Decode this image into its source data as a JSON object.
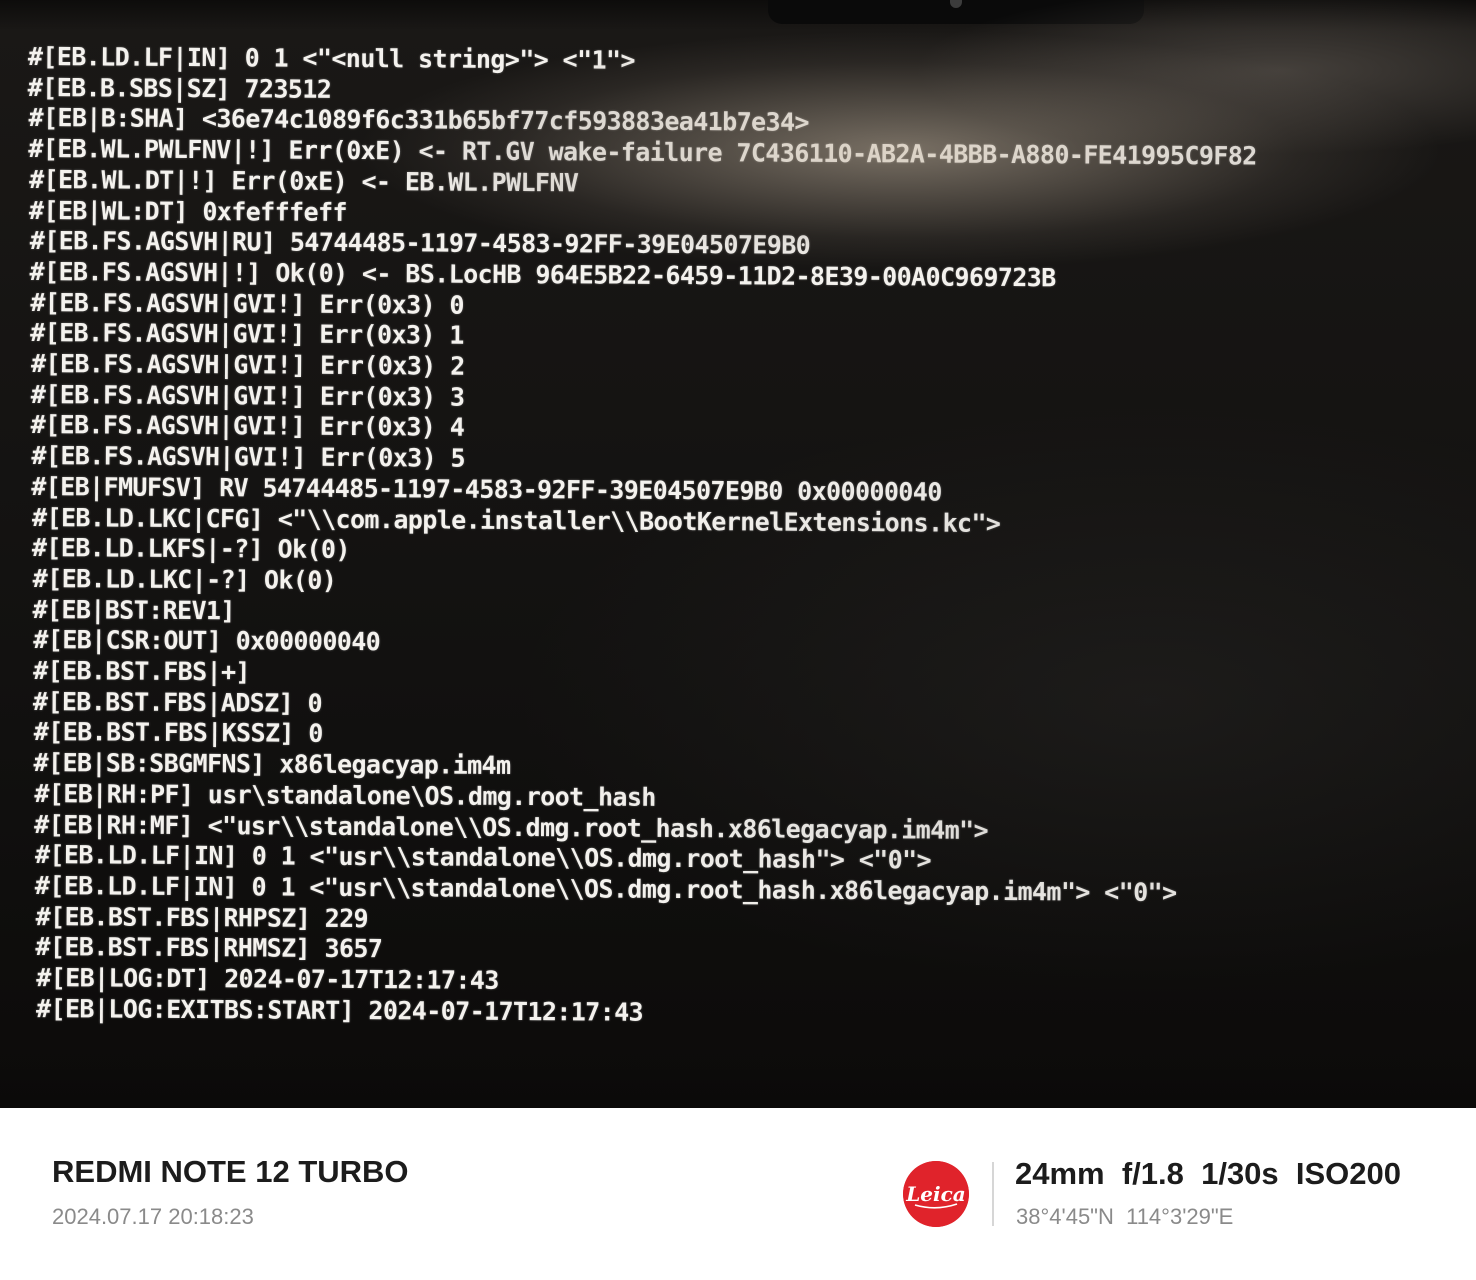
{
  "terminal": {
    "lines": [
      "#[EB.LD.LF|IN] 0 1 <\"<null string>\"> <\"1\">",
      "#[EB.B.SBS|SZ] 723512",
      "#[EB|B:SHA] <36e74c1089f6c331b65bf77cf593883ea41b7e34>",
      "#[EB.WL.PWLFNV|!] Err(0xE) <- RT.GV wake-failure 7C436110-AB2A-4BBB-A880-FE41995C9F82",
      "#[EB.WL.DT|!] Err(0xE) <- EB.WL.PWLFNV",
      "#[EB|WL:DT] 0xfefffeff",
      "#[EB.FS.AGSVH|RU] 54744485-1197-4583-92FF-39E04507E9B0",
      "#[EB.FS.AGSVH|!] Ok(0) <- BS.LocHB 964E5B22-6459-11D2-8E39-00A0C969723B",
      "#[EB.FS.AGSVH|GVI!] Err(0x3) 0",
      "#[EB.FS.AGSVH|GVI!] Err(0x3) 1",
      "#[EB.FS.AGSVH|GVI!] Err(0x3) 2",
      "#[EB.FS.AGSVH|GVI!] Err(0x3) 3",
      "#[EB.FS.AGSVH|GVI!] Err(0x3) 4",
      "#[EB.FS.AGSVH|GVI!] Err(0x3) 5",
      "#[EB|FMUFSV] RV 54744485-1197-4583-92FF-39E04507E9B0 0x00000040",
      "#[EB.LD.LKC|CFG] <\"\\\\com.apple.installer\\\\BootKernelExtensions.kc\">",
      "#[EB.LD.LKFS|-?] Ok(0)",
      "#[EB.LD.LKC|-?] Ok(0)",
      "#[EB|BST:REV1]",
      "#[EB|CSR:OUT] 0x00000040",
      "#[EB.BST.FBS|+]",
      "#[EB.BST.FBS|ADSZ] 0",
      "#[EB.BST.FBS|KSSZ] 0",
      "#[EB|SB:SBGMFNS] x86legacyap.im4m",
      "#[EB|RH:PF] usr\\standalone\\OS.dmg.root_hash",
      "#[EB|RH:MF] <\"usr\\\\standalone\\\\OS.dmg.root_hash.x86legacyap.im4m\">",
      "#[EB.LD.LF|IN] 0 1 <\"usr\\\\standalone\\\\OS.dmg.root_hash\"> <\"0\">",
      "#[EB.LD.LF|IN] 0 1 <\"usr\\\\standalone\\\\OS.dmg.root_hash.x86legacyap.im4m\"> <\"0\">",
      "#[EB.BST.FBS|RHPSZ] 229",
      "#[EB.BST.FBS|RHMSZ] 3657",
      "#[EB|LOG:DT] 2024-07-17T12:17:43",
      "#[EB|LOG:EXITBS:START] 2024-07-17T12:17:43"
    ]
  },
  "watermark": {
    "device_model": "REDMI NOTE 12 TURBO",
    "capture_datetime": "2024.07.17  20:18:23",
    "brand_logo_text": "Leica",
    "brand_color": "#e0232b",
    "exif_line": "24mm  f/1.8  1/30s  ISO200",
    "gps_line": "38°4'45\"N  114°3'29\"E"
  }
}
